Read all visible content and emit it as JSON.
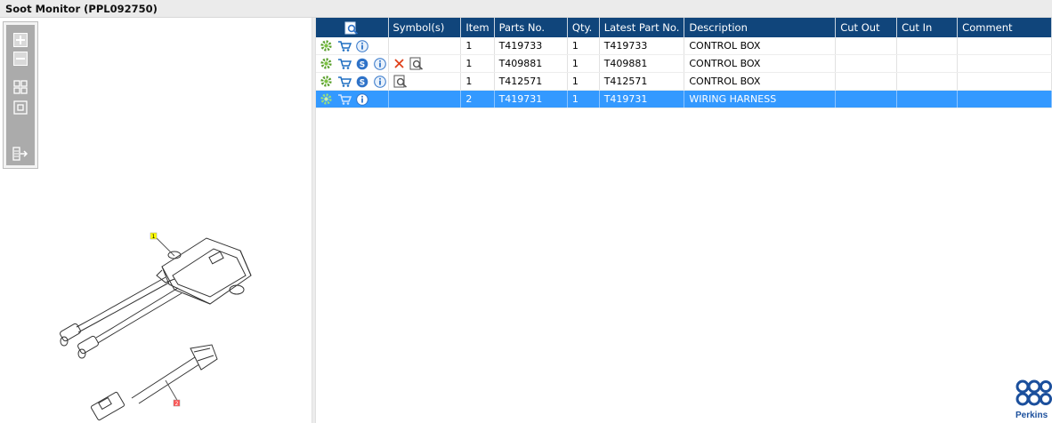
{
  "window": {
    "title": "Soot Monitor (PPL092750)"
  },
  "toolbox": {
    "tools": [
      "zoom-in-icon",
      "zoom-out-icon",
      "fit-all-icon",
      "actual-size-icon",
      "export-icon"
    ]
  },
  "drawing": {
    "callouts": [
      {
        "label": "1",
        "color": "#ffff00"
      },
      {
        "label": "2",
        "color": "#ff5555"
      }
    ]
  },
  "grid": {
    "header_icon": "search-document-icon",
    "columns": [
      "Symbol(s)",
      "Item",
      "Parts No.",
      "Qty.",
      "Latest Part No.",
      "Description",
      "Cut Out",
      "Cut In",
      "Comment"
    ],
    "rows": [
      {
        "actions": [
          "gear-icon",
          "cart-icon",
          "info-icon"
        ],
        "symbols": [],
        "item": "1",
        "part_no": "T419733",
        "qty": "1",
        "latest_part_no": "T419733",
        "description": "CONTROL BOX",
        "cut_out": "",
        "cut_in": "",
        "comment": "",
        "selected": false
      },
      {
        "actions": [
          "gear-icon",
          "cart-icon",
          "s-icon",
          "info-icon"
        ],
        "symbols": [
          "cross-icon",
          "search-document-icon"
        ],
        "item": "1",
        "part_no": "T409881",
        "qty": "1",
        "latest_part_no": "T409881",
        "description": "CONTROL BOX",
        "cut_out": "",
        "cut_in": "",
        "comment": "",
        "selected": false
      },
      {
        "actions": [
          "gear-icon",
          "cart-icon",
          "s-icon",
          "info-icon"
        ],
        "symbols": [
          "search-document-icon"
        ],
        "item": "1",
        "part_no": "T412571",
        "qty": "1",
        "latest_part_no": "T412571",
        "description": "CONTROL BOX",
        "cut_out": "",
        "cut_in": "",
        "comment": "",
        "selected": false
      },
      {
        "actions": [
          "gear-icon",
          "cart-icon",
          "info-icon"
        ],
        "symbols": [],
        "item": "2",
        "part_no": "T419731",
        "qty": "1",
        "latest_part_no": "T419731",
        "description": "WIRING HARNESS",
        "cut_out": "",
        "cut_in": "",
        "comment": "",
        "selected": true
      }
    ]
  },
  "brand": {
    "name": "Perkins",
    "color": "#1b4f9c"
  },
  "colors": {
    "header_bg": "#10457b",
    "selected_row": "#3399ff"
  }
}
